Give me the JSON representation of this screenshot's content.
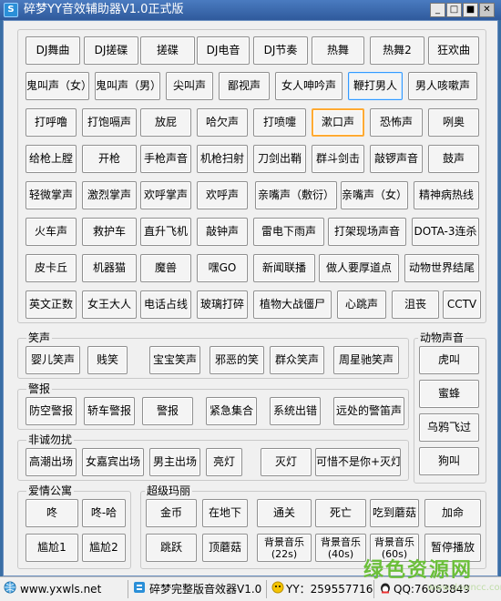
{
  "window": {
    "title": "碎梦YY音效辅助器V1.0正式版",
    "icon": "app-icon",
    "min": "_",
    "restore": "□",
    "max": "■",
    "close": "✕"
  },
  "main_buttons": [
    [
      "DJ舞曲",
      "DJ搓碟",
      "搓碟",
      "DJ电音",
      "DJ节奏",
      "热舞",
      "热舞2",
      "狂欢曲"
    ],
    [
      "鬼叫声（女）",
      "鬼叫声（男）",
      "尖叫声",
      "鄙视声",
      "女人呻吟声",
      "鞭打男人",
      "男人咳嗽声"
    ],
    [
      "打呼噜",
      "打饱嗝声",
      "放屁",
      "哈欠声",
      "打喷嚏",
      "漱口声",
      "恐怖声",
      "咧奥"
    ],
    [
      "给枪上膛",
      "开枪",
      "手枪声音",
      "机枪扫射",
      "刀剑出鞘",
      "群斗剑击",
      "敲锣声音",
      "鼓声"
    ],
    [
      "轻微掌声",
      "激烈掌声",
      "欢呼掌声",
      "欢呼声",
      "亲嘴声（敷衍）",
      "亲嘴声（女）",
      "精神病热线"
    ],
    [
      "火车声",
      "救护车",
      "直升飞机",
      "敲钟声",
      "雷电下雨声",
      "打架现场声音",
      "DOTA-3连杀"
    ],
    [
      "皮卡丘",
      "机器猫",
      "魔兽",
      "嘿GO",
      "新闻联播",
      "做人要厚道点",
      "动物世界结尾"
    ],
    [
      "英文正数",
      "女王大人",
      "电话占线",
      "玻璃打碎",
      "植物大战僵尸",
      "心跳声",
      "沮丧",
      "CCTV"
    ]
  ],
  "groups": {
    "laugh": {
      "label": "笑声",
      "buttons": [
        "婴儿笑声",
        "贱笑",
        "宝宝笑声",
        "邪恶的笑",
        "群众笑声",
        "周星驰笑声"
      ]
    },
    "alarm": {
      "label": "警报",
      "buttons": [
        "防空警报",
        "轿车警报",
        "警报",
        "紧急集合",
        "系统出错",
        "远处的警笛声"
      ]
    },
    "dating": {
      "label": "非诚勿扰",
      "buttons": [
        "高潮出场",
        "女嘉宾出场",
        "男主出场",
        "亮灯",
        "灭灯",
        "可惜不是你+灭灯"
      ]
    },
    "animal": {
      "label": "动物声音",
      "buttons": [
        "虎叫",
        "蜜蜂",
        "乌鸦飞过",
        "狗叫"
      ]
    },
    "love": {
      "label": "爱情公寓",
      "buttons": [
        "咚",
        "咚-哈",
        "尴尬1",
        "尴尬2"
      ]
    },
    "mario": {
      "label": "超级玛丽",
      "buttons": [
        "金币",
        "在地下",
        "通关",
        "死亡",
        "吃到蘑菇",
        "加命"
      ],
      "buttons2": [
        "跳跃",
        "顶蘑菇"
      ],
      "bgm": [
        {
          "l1": "背景音乐",
          "l2": "(22s)"
        },
        {
          "l1": "背景音乐",
          "l2": "(40s)"
        },
        {
          "l1": "背景音乐",
          "l2": "(60s)"
        }
      ],
      "stop": "暂停播放"
    }
  },
  "statusbar": {
    "website": "www.yxwls.net",
    "product": "碎梦完整版音效器V1.0",
    "yy": "YY：259557716",
    "qq": "QQ:76063849"
  },
  "watermark": {
    "main": "绿色资源网",
    "sub": "www.downcc.com"
  },
  "colors": {
    "selected_border": "#3399ff",
    "focused_border": "#ffaa33",
    "title_bar": "#2f5a9c"
  }
}
